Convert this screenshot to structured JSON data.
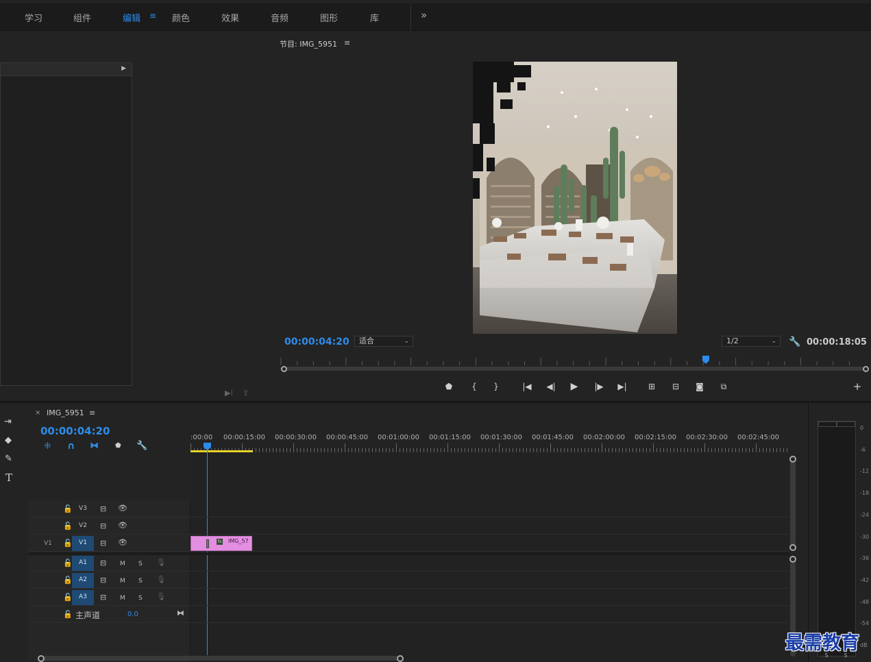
{
  "workspaces": [
    {
      "label": "学习",
      "active": false
    },
    {
      "label": "组件",
      "active": false
    },
    {
      "label": "编辑",
      "active": true
    },
    {
      "label": "颜色",
      "active": false
    },
    {
      "label": "效果",
      "active": false
    },
    {
      "label": "音频",
      "active": false
    },
    {
      "label": "图形",
      "active": false
    },
    {
      "label": "库",
      "active": false
    }
  ],
  "more_label": "»",
  "menu_icon": "≡",
  "program": {
    "title": "节目: IMG_5951",
    "current_time": "00:00:04:20",
    "fit_label": "适合",
    "resolution": "1/2",
    "duration": "00:00:18:05",
    "playhead_fraction": 0.264
  },
  "timeline": {
    "sequence_name": "IMG_5951",
    "close_label": "×",
    "current_time": "00:00:04:20",
    "ruler_labels": [
      ":00:00",
      "00:00:15:00",
      "00:00:30:00",
      "00:00:45:00",
      "00:01:00:00",
      "00:01:15:00",
      "00:01:30:00",
      "00:01:45:00",
      "00:02:00:00",
      "00:02:15:00",
      "00:02:30:00",
      "00:02:45:00"
    ],
    "video_tracks": [
      {
        "name": "V3",
        "source": ""
      },
      {
        "name": "V2",
        "source": ""
      },
      {
        "name": "V1",
        "source": "V1"
      }
    ],
    "audio_tracks": [
      {
        "name": "A1",
        "m": "M",
        "s": "S"
      },
      {
        "name": "A2",
        "m": "M",
        "s": "S"
      },
      {
        "name": "A3",
        "m": "M",
        "s": "S"
      }
    ],
    "master": {
      "label": "主声道",
      "value": "0.0"
    },
    "clip": {
      "label": "IMG_57",
      "badge": "fx"
    }
  },
  "meter": {
    "labels": [
      "0",
      "-6",
      "-12",
      "-18",
      "-24",
      "-30",
      "-36",
      "-42",
      "-48",
      "-54",
      "dB"
    ],
    "solo": [
      "S",
      "S"
    ]
  },
  "watermark": "最需教育",
  "colors": {
    "accent": "#2d8ceb",
    "clip": "#e38ee0",
    "work_area": "#e6d22a"
  }
}
